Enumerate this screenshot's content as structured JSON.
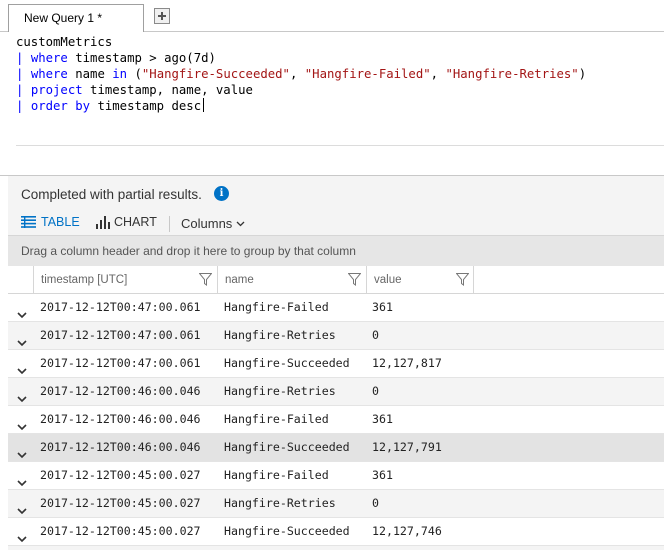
{
  "tabs": [
    {
      "label": "New Query 1 *"
    }
  ],
  "editor": {
    "line1": "customMetrics",
    "line2_kw": "where",
    "line2_text": " timestamp > ago(7d)",
    "line3_kw": "where",
    "line3_mid": " name ",
    "line3_in": "in",
    "line3_open": " (",
    "line3_s1": "\"Hangfire-Succeeded\"",
    "line3_c1": ", ",
    "line3_s2": "\"Hangfire-Failed\"",
    "line3_c2": ", ",
    "line3_s3": "\"Hangfire-Retries\"",
    "line3_close": ")",
    "line4_kw": "project",
    "line4_text": " timestamp, name, value",
    "line5_kw": "order by",
    "line5_text": " timestamp desc",
    "pipe": "|"
  },
  "results": {
    "status": "Completed with partial results.",
    "info_icon": "info-icon",
    "info_glyph": "i"
  },
  "toolbar": {
    "table_label": "TABLE",
    "chart_label": "CHART",
    "columns_label": "Columns",
    "accent_color": "#0072c6"
  },
  "grid": {
    "group_hint": "Drag a column header and drop it here to group by that column",
    "columns": [
      "timestamp [UTC]",
      "name",
      "value"
    ],
    "rows": [
      {
        "timestamp": "2017-12-12T00:47:00.061",
        "name": "Hangfire-Failed",
        "value": "361"
      },
      {
        "timestamp": "2017-12-12T00:47:00.061",
        "name": "Hangfire-Retries",
        "value": "0"
      },
      {
        "timestamp": "2017-12-12T00:47:00.061",
        "name": "Hangfire-Succeeded",
        "value": "12,127,817"
      },
      {
        "timestamp": "2017-12-12T00:46:00.046",
        "name": "Hangfire-Retries",
        "value": "0"
      },
      {
        "timestamp": "2017-12-12T00:46:00.046",
        "name": "Hangfire-Failed",
        "value": "361"
      },
      {
        "timestamp": "2017-12-12T00:46:00.046",
        "name": "Hangfire-Succeeded",
        "value": "12,127,791"
      },
      {
        "timestamp": "2017-12-12T00:45:00.027",
        "name": "Hangfire-Failed",
        "value": "361"
      },
      {
        "timestamp": "2017-12-12T00:45:00.027",
        "name": "Hangfire-Retries",
        "value": "0"
      },
      {
        "timestamp": "2017-12-12T00:45:00.027",
        "name": "Hangfire-Succeeded",
        "value": "12,127,746"
      }
    ]
  }
}
